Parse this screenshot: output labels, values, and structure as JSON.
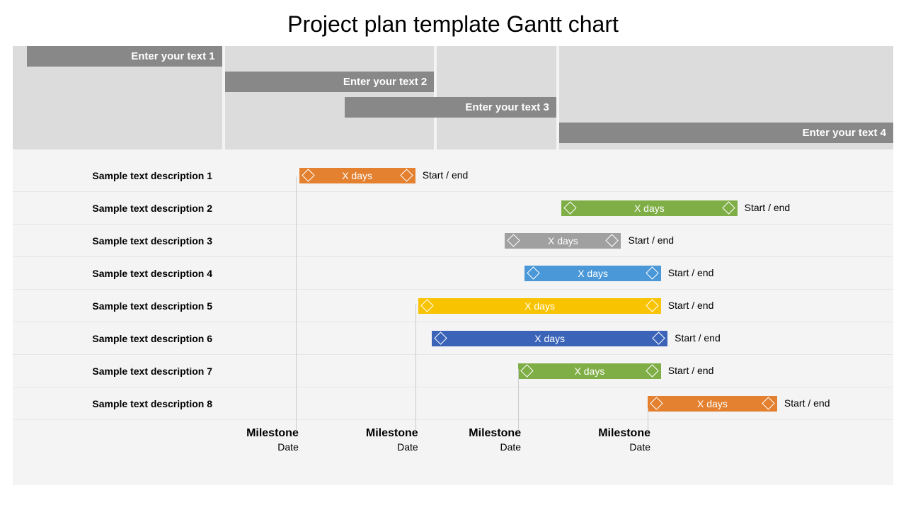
{
  "title": "Project plan template Gantt chart",
  "phases": [
    {
      "label": "Enter your text 1"
    },
    {
      "label": "Enter your text 2"
    },
    {
      "label": "Enter your text 3"
    },
    {
      "label": "Enter your text 4"
    }
  ],
  "tasks": [
    {
      "label": "Sample text description 1",
      "duration": "X days",
      "endLabel": "Start / end",
      "color": "c-orange",
      "leftPct": 12.0,
      "widthPct": 17.5
    },
    {
      "label": "Sample text description 2",
      "duration": "X days",
      "endLabel": "Start / end",
      "color": "c-green",
      "leftPct": 51.5,
      "widthPct": 26.5
    },
    {
      "label": "Sample text description 3",
      "duration": "X days",
      "endLabel": "Start / end",
      "color": "c-gray",
      "leftPct": 43.0,
      "widthPct": 17.5
    },
    {
      "label": "Sample text description 4",
      "duration": "X days",
      "endLabel": "Start / end",
      "color": "c-blue",
      "leftPct": 46.0,
      "widthPct": 20.5
    },
    {
      "label": "Sample text description 5",
      "duration": "X days",
      "endLabel": "Start / end",
      "color": "c-yellow",
      "leftPct": 30.0,
      "widthPct": 36.5
    },
    {
      "label": "Sample text description 6",
      "duration": "X days",
      "endLabel": "Start / end",
      "color": "c-dblue",
      "leftPct": 32.0,
      "widthPct": 35.5
    },
    {
      "label": "Sample text description 7",
      "duration": "X days",
      "endLabel": "Start / end",
      "color": "c-green",
      "leftPct": 45.0,
      "widthPct": 21.5
    },
    {
      "label": "Sample text description 8",
      "duration": "X days",
      "endLabel": "Start / end",
      "color": "c-orange",
      "leftPct": 64.5,
      "widthPct": 19.5
    }
  ],
  "milestones": [
    {
      "title": "Milestone",
      "date": "Date",
      "posPct": 11.5,
      "lineTopPx": 24,
      "lineHeightPx": 358
    },
    {
      "title": "Milestone",
      "date": "Date",
      "posPct": 29.5,
      "lineTopPx": 204,
      "lineHeightPx": 178
    },
    {
      "title": "Milestone",
      "date": "Date",
      "posPct": 45.0,
      "lineTopPx": 296,
      "lineHeightPx": 86
    },
    {
      "title": "Milestone",
      "date": "Date",
      "posPct": 64.5,
      "lineTopPx": 352,
      "lineHeightPx": 30
    }
  ],
  "chart_data": {
    "type": "bar",
    "title": "Project plan template Gantt chart",
    "xlabel": "",
    "ylabel": "",
    "phases": [
      "Enter your text 1",
      "Enter your text 2",
      "Enter your text 3",
      "Enter your text 4"
    ],
    "series": [
      {
        "name": "Sample text description 1",
        "start": 12.0,
        "end": 29.5,
        "duration_label": "X days",
        "color": "#e38131"
      },
      {
        "name": "Sample text description 2",
        "start": 51.5,
        "end": 78.0,
        "duration_label": "X days",
        "color": "#7fae46"
      },
      {
        "name": "Sample text description 3",
        "start": 43.0,
        "end": 60.5,
        "duration_label": "X days",
        "color": "#a0a0a0"
      },
      {
        "name": "Sample text description 4",
        "start": 46.0,
        "end": 66.5,
        "duration_label": "X days",
        "color": "#4a98d8"
      },
      {
        "name": "Sample text description 5",
        "start": 30.0,
        "end": 66.5,
        "duration_label": "X days",
        "color": "#f8c300"
      },
      {
        "name": "Sample text description 6",
        "start": 32.0,
        "end": 67.5,
        "duration_label": "X days",
        "color": "#3b64b8"
      },
      {
        "name": "Sample text description 7",
        "start": 45.0,
        "end": 66.5,
        "duration_label": "X days",
        "color": "#7fae46"
      },
      {
        "name": "Sample text description 8",
        "start": 64.5,
        "end": 84.0,
        "duration_label": "X days",
        "color": "#e38131"
      }
    ],
    "milestones": [
      {
        "label": "Milestone",
        "date": "Date",
        "position": 11.5
      },
      {
        "label": "Milestone",
        "date": "Date",
        "position": 29.5
      },
      {
        "label": "Milestone",
        "date": "Date",
        "position": 45.0
      },
      {
        "label": "Milestone",
        "date": "Date",
        "position": 64.5
      }
    ]
  }
}
